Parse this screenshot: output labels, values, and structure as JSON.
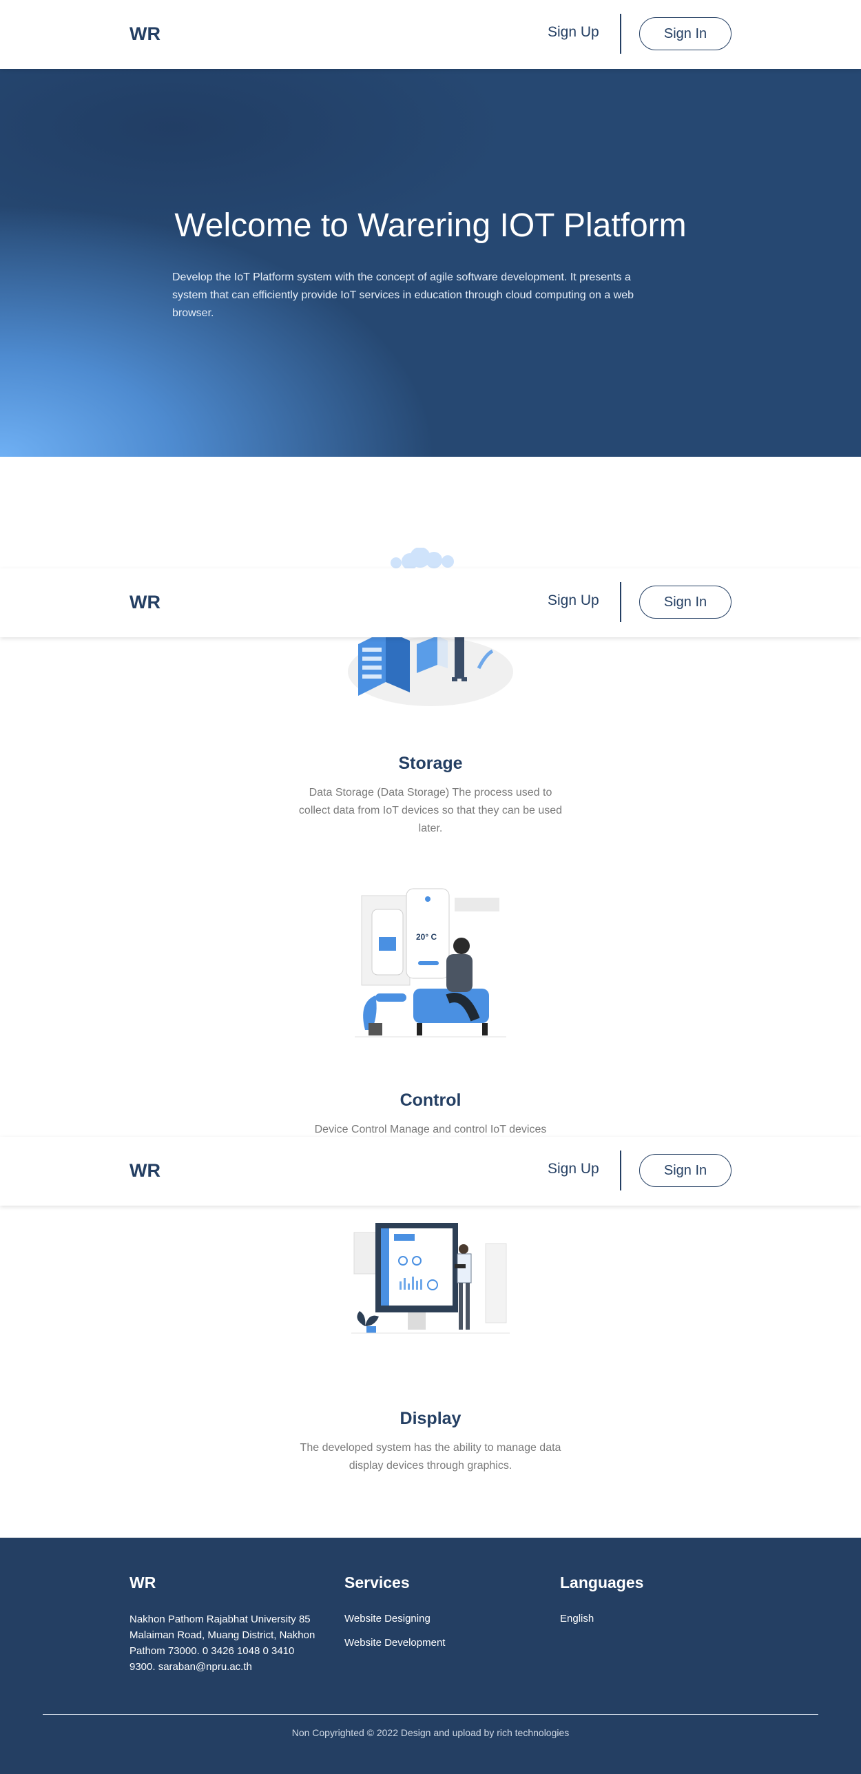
{
  "nav": {
    "logo": "WR",
    "sign_up": "Sign Up",
    "sign_in": "Sign In"
  },
  "hero": {
    "title": "Welcome to Warering IOT Platform",
    "description": "Develop the IoT Platform system with the concept of agile software development. It presents a system that can efficiently provide IoT services in education through cloud computing on a web browser."
  },
  "features": [
    {
      "title": "Storage",
      "description": "Data Storage (Data Storage) The process used to collect data from IoT devices so that they can be used later."
    },
    {
      "title": "Control",
      "description": "Device Control Manage and control IoT devices",
      "illustration_text": "20° C"
    },
    {
      "title": "Display",
      "description": "The developed system has the ability to manage data display devices through graphics."
    }
  ],
  "footer": {
    "brand": "WR",
    "address": "Nakhon Pathom Rajabhat University 85 Malaiman Road, Muang District, Nakhon Pathom 73000. 0 3426 1048 0 3410 9300. saraban@npru.ac.th",
    "services_title": "Services",
    "services": [
      "Website Designing",
      "Website Development"
    ],
    "languages_title": "Languages",
    "languages": [
      "English"
    ],
    "copyright": "Non Copyrighted © 2022 Design and upload by rich technologies"
  },
  "colors": {
    "navy": "#243f63",
    "hero_light": "#6fb0f4",
    "accent_blue": "#4a90e2"
  }
}
